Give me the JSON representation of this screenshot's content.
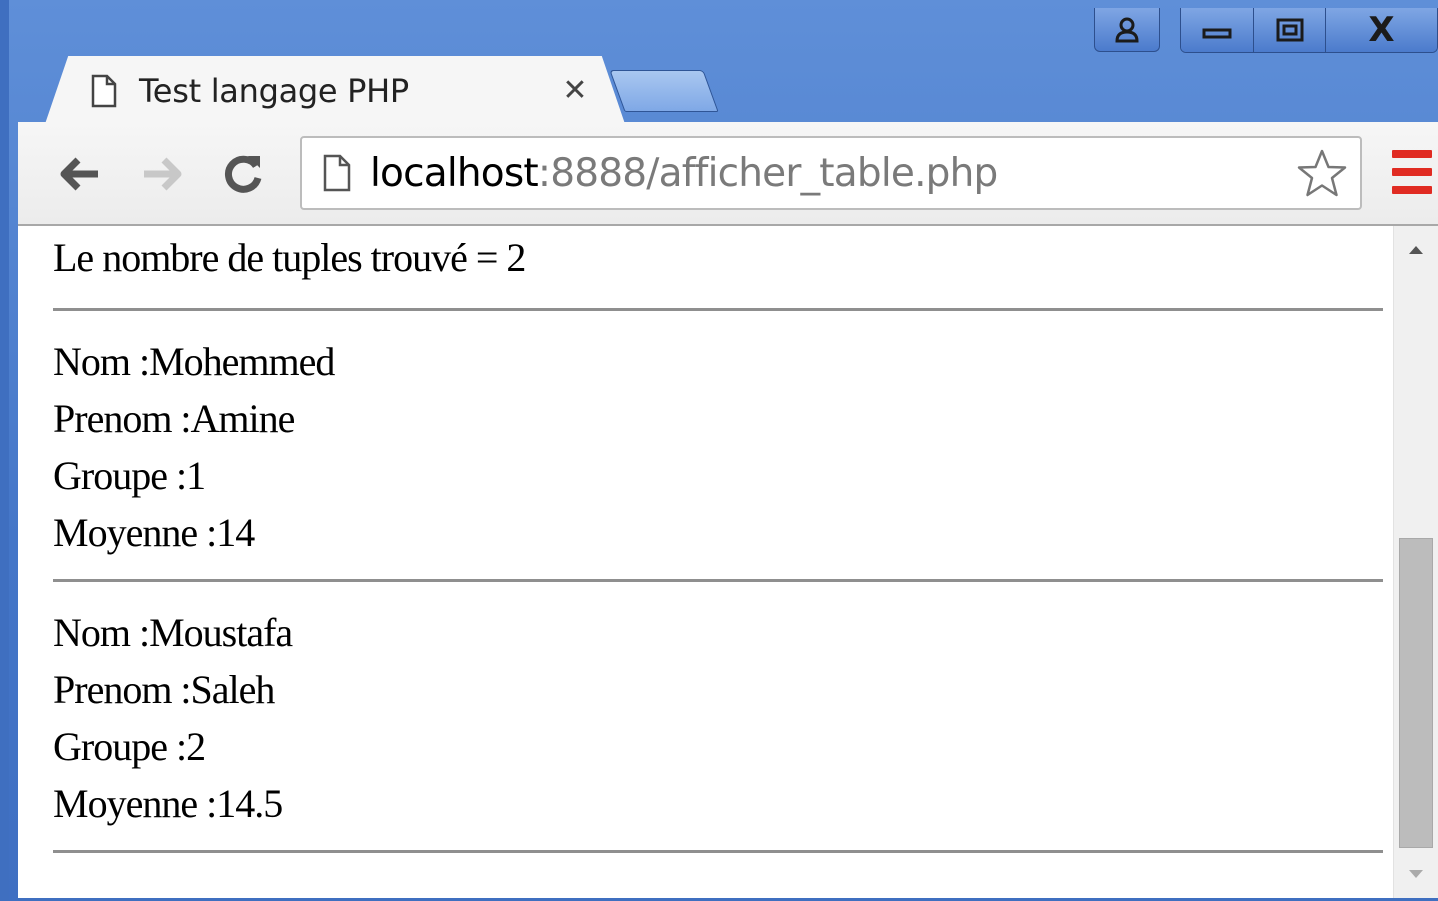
{
  "window": {
    "controls": {
      "user_icon": "user-icon",
      "minimize_icon": "minimize-icon",
      "maximize_icon": "restore-icon",
      "close_label": "X"
    }
  },
  "tab": {
    "title": "Test langage PHP",
    "close_label": "✕",
    "icon": "page-icon"
  },
  "toolbar": {
    "back_icon": "back-arrow-icon",
    "forward_icon": "forward-arrow-icon",
    "reload_icon": "reload-icon",
    "url_host": "localhost",
    "url_rest": ":8888/afficher_table.php",
    "star_icon": "star-icon",
    "menu_icon": "menu-icon",
    "menu_color": "#e02b22"
  },
  "page": {
    "count_line": "Le nombre de tuples trouvé = 2",
    "records": [
      {
        "nom": "Nom :Mohemmed",
        "prenom": "Prenom :Amine",
        "groupe": "Groupe :1",
        "moyenne": "Moyenne :14"
      },
      {
        "nom": "Nom :Moustafa",
        "prenom": "Prenom :Saleh",
        "groupe": "Groupe :2",
        "moyenne": "Moyenne :14.5"
      }
    ]
  }
}
